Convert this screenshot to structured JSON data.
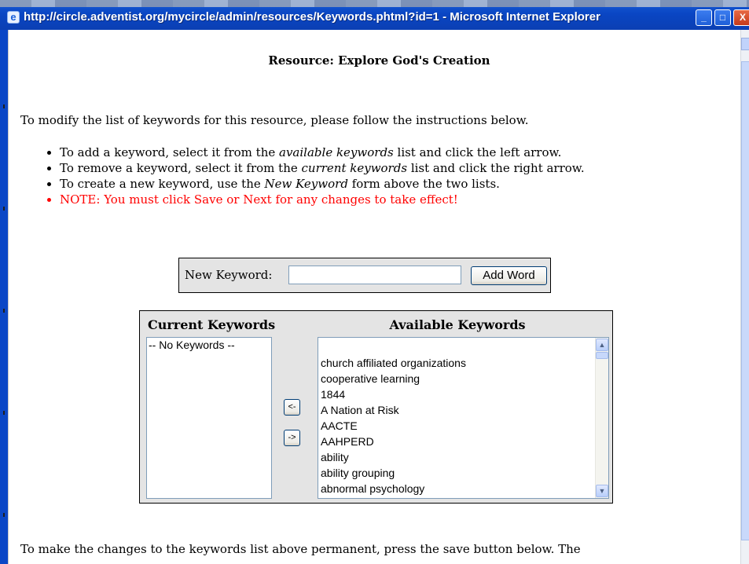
{
  "window": {
    "title": "http://circle.adventist.org/mycircle/admin/resources/Keywords.phtml?id=1 - Microsoft Internet Explorer",
    "minimize_label": "_",
    "maximize_label": "□",
    "close_label": "X"
  },
  "page": {
    "resource_title": "Resource: Explore God's Creation",
    "intro": "To modify the list of keywords for this resource, please follow the instructions below.",
    "instructions": [
      {
        "pre": "To add a keyword, select it from the ",
        "em": "available keywords",
        "post": " list and click the left arrow."
      },
      {
        "pre": "To remove a keyword, select it from the ",
        "em": "current keywords",
        "post": " list and click the right arrow."
      },
      {
        "pre": "To create a new keyword, use the ",
        "em": "New Keyword",
        "post": " form above the two lists."
      }
    ],
    "note": "NOTE: You must click Save or Next for any changes to take effect!",
    "bottom_text": "To make the changes to the keywords list above permanent, press the save button below. The"
  },
  "new_keyword": {
    "label": "New Keyword:",
    "value": "",
    "button_label": "Add Word"
  },
  "current_keywords": {
    "heading": "Current Keywords",
    "items": [
      "-- No Keywords --"
    ]
  },
  "available_keywords": {
    "heading": "Available Keywords",
    "items": [
      "church affiliated organizations",
      "cooperative learning",
      "1844",
      "A Nation at Risk",
      "AACTE",
      "AAHPERD",
      "ability",
      "ability grouping",
      "abnormal psychology"
    ]
  },
  "arrows": {
    "add_label": "<-",
    "remove_label": "->"
  }
}
